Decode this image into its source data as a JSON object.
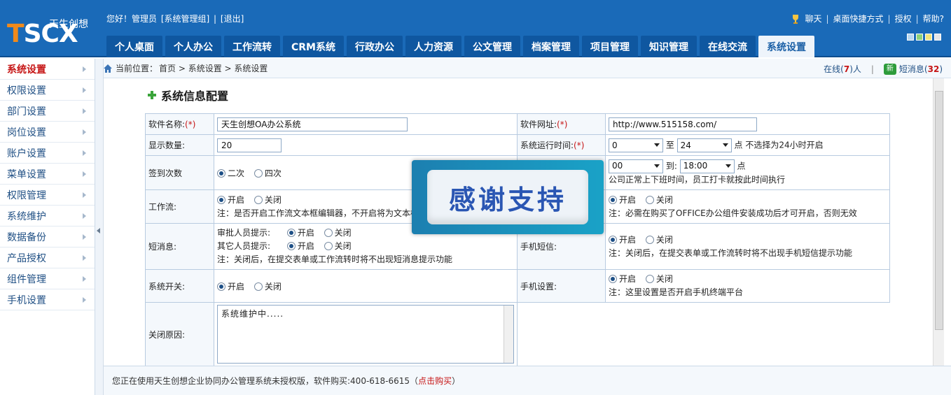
{
  "logo": {
    "main_t": "T",
    "main_rest": "SCX",
    "sub": "天生创想"
  },
  "greeting": {
    "hello": "您好！管理员",
    "group": "[系统管理组]",
    "logout": "[退出]"
  },
  "toplinks": [
    "聊天",
    "桌面快捷方式",
    "授权",
    "帮助?"
  ],
  "skins": [
    "#b9d7ef",
    "#8fd37a",
    "#f2e47a",
    "#e6e6e6"
  ],
  "nav": [
    "个人桌面",
    "个人办公",
    "工作流转",
    "CRM系统",
    "行政办公",
    "人力资源",
    "公文管理",
    "档案管理",
    "项目管理",
    "知识管理",
    "在线交流",
    "系统设置"
  ],
  "nav_active": "系统设置",
  "sidebar": [
    "系统设置",
    "权限设置",
    "部门设置",
    "岗位设置",
    "账户设置",
    "菜单设置",
    "权限管理",
    "系统维护",
    "数据备份",
    "产品授权",
    "组件管理",
    "手机设置"
  ],
  "breadcrumb": {
    "label": "当前位置：",
    "path": "首页 > 系统设置 > 系统设置"
  },
  "online": {
    "prefix": "在线(",
    "count": "7",
    "suffix": ")人"
  },
  "messages": {
    "icon_text": "新",
    "prefix": "短消息(",
    "count": "32",
    "suffix": ")"
  },
  "section_title": "系统信息配置",
  "form": {
    "software_name": {
      "label": "软件名称:",
      "req": "(*)",
      "value": "天生创想OA办公系统"
    },
    "software_url": {
      "label": "软件网址:",
      "req": "(*)",
      "value": "http://www.515158.com/"
    },
    "display_count": {
      "label": "显示数量:",
      "value": "20"
    },
    "run_time": {
      "label": "系统运行时间:",
      "req": "(*)",
      "from": "0",
      "to_label": "至",
      "to": "24",
      "unit": "点",
      "note": "不选择为24小时开启"
    },
    "signin": {
      "label": "签到次数",
      "opt1": "二次",
      "opt2": "四次"
    },
    "work_time": {
      "from": "00",
      "to_label": "到:",
      "to": "18:00",
      "unit": "点",
      "note": "公司正常上下班时间，员工打卡就按此时间执行"
    },
    "workflow": {
      "label": "工作流:",
      "opt1": "开启",
      "opt2": "关闭",
      "note": "注：是否开启工作流文本框编辑器，不开启将为文本框"
    },
    "office": {
      "opt1": "开启",
      "opt2": "关闭",
      "note": "注：必需在购买了OFFICE办公组件安装成功后才可开启，否则无效"
    },
    "sms": {
      "label": "短消息:",
      "approver": "审批人员提示:",
      "others": "其它人员提示:",
      "opt1": "开启",
      "opt2": "关闭",
      "note": "注：关闭后，在提交表单或工作流转时将不出现短消息提示功能"
    },
    "mobile_sms": {
      "label": "手机短信:",
      "opt1": "开启",
      "opt2": "关闭",
      "note": "注：关闭后，在提交表单或工作流转时将不出现手机短信提示功能"
    },
    "switch": {
      "label": "系统开关:",
      "opt1": "开启",
      "opt2": "关闭"
    },
    "mobile": {
      "label": "手机设置:",
      "opt1": "开启",
      "opt2": "关闭",
      "note": "注：这里设置是否开启手机终端平台"
    },
    "close_reason": {
      "label": "关闭原因:",
      "value": "系统维护中....."
    }
  },
  "footer": {
    "text": "您正在使用天生创想企业协同办公管理系统未授权版，软件购买:400-618-6615（",
    "buy": "点击购买",
    "end": "）"
  },
  "overlay": "感谢支持"
}
